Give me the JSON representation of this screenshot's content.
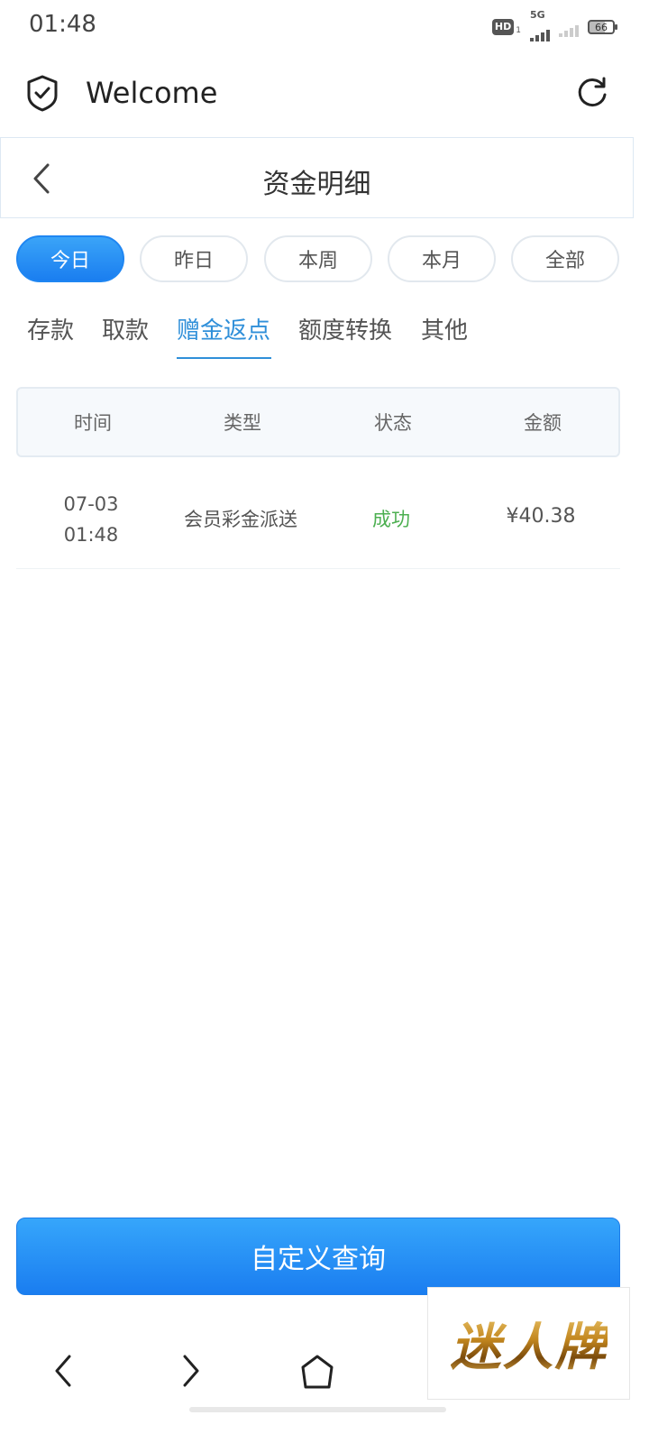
{
  "status_bar": {
    "time": "01:48",
    "hd_label": "HD",
    "hd_sub": "1",
    "network": "5G",
    "battery": "66"
  },
  "header": {
    "title": "Welcome"
  },
  "nav": {
    "title": "资金明细"
  },
  "period_filters": [
    {
      "label": "今日",
      "active": true
    },
    {
      "label": "昨日",
      "active": false
    },
    {
      "label": "本周",
      "active": false
    },
    {
      "label": "本月",
      "active": false
    },
    {
      "label": "全部",
      "active": false
    }
  ],
  "category_tabs": [
    {
      "label": "存款",
      "active": false
    },
    {
      "label": "取款",
      "active": false
    },
    {
      "label": "赠金返点",
      "active": true
    },
    {
      "label": "额度转换",
      "active": false
    },
    {
      "label": "其他",
      "active": false
    }
  ],
  "table": {
    "headers": [
      "时间",
      "类型",
      "状态",
      "金额"
    ],
    "rows": [
      {
        "date": "07-03",
        "time": "01:48",
        "type": "会员彩金派送",
        "status": "成功",
        "amount": "¥40.38"
      }
    ]
  },
  "query_button": {
    "label": "自定义查询"
  },
  "watermark": {
    "text": "迷人牌"
  },
  "colors": {
    "accent": "#1a7ef0",
    "tab_active": "#2f8fd9",
    "success": "#4caf50"
  }
}
